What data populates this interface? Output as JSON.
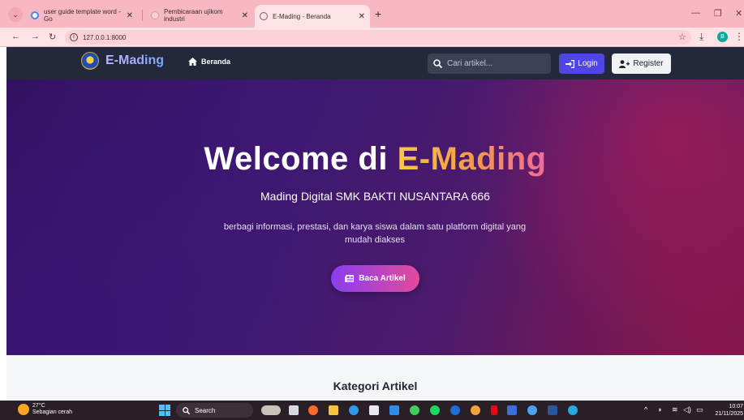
{
  "browser": {
    "tabs": [
      {
        "label": "user guide template word - Go",
        "active": false
      },
      {
        "label": "Pembicaraan ujikom industri",
        "active": false
      },
      {
        "label": "E-Mading - Beranda",
        "active": true
      }
    ],
    "url": "127.0.0.1:8000"
  },
  "navbar": {
    "brand": "E-Mading",
    "home_label": "Beranda",
    "search_placeholder": "Cari artikel...",
    "login_label": "Login",
    "register_label": "Register"
  },
  "hero": {
    "title_main": "Welcome di ",
    "title_accent": "E-Mading",
    "subtitle": "Mading Digital SMK BAKTI NUSANTARA 666",
    "description": "berbagi informasi, prestasi, dan karya siswa dalam satu platform digital yang mudah diakses",
    "cta_label": "Baca Artikel"
  },
  "section": {
    "title": "Kategori Artikel"
  },
  "taskbar": {
    "weather_temp": "27°C",
    "weather_desc": "Sebagian cerah",
    "search_label": "Search",
    "time": "10:07",
    "date": "21/11/2025"
  },
  "colors": {
    "navbar_bg": "#24283b",
    "login_button": "#4f46e5",
    "hero_accent_start": "#f7c845",
    "hero_accent_end": "#ef6b9c",
    "cta_start": "#8a3df0",
    "cta_end": "#e24a9a"
  }
}
